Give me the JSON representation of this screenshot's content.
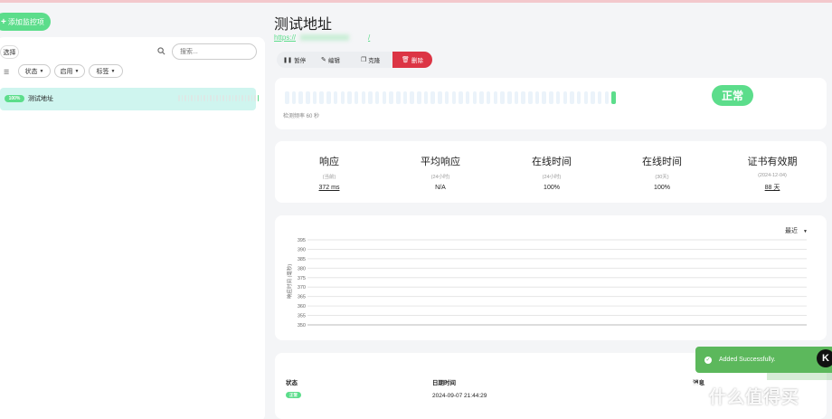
{
  "sidebar": {
    "add_button_label": "添加监控项",
    "select_button_label": "选择",
    "search_placeholder": "搜索...",
    "filters": [
      {
        "label": "状态"
      },
      {
        "label": "启用"
      },
      {
        "label": "标签"
      }
    ],
    "monitors": [
      {
        "uptime_badge": "100%",
        "name": "测试地址",
        "bars_total": 26,
        "bars_up": [
          25
        ]
      }
    ]
  },
  "monitor": {
    "title": "测试地址",
    "url_prefix": "https://",
    "url_suffix": "/",
    "actions": {
      "pause": "暂停",
      "edit": "编辑",
      "clone": "克隆",
      "delete": "删除"
    },
    "heartbeat": {
      "bars_total": 48,
      "up_indices": [
        47
      ],
      "interval_note": "检测频率 60 秒",
      "status_label": "正常"
    },
    "stats": [
      {
        "label": "响应",
        "sub": "(当前)",
        "value": "372 ms",
        "underline": true
      },
      {
        "label": "平均响应",
        "sub": "(24小时)",
        "value": "N/A",
        "underline": false
      },
      {
        "label": "在线时间",
        "sub": "(24小时)",
        "value": "100%",
        "underline": false
      },
      {
        "label": "在线时间",
        "sub": "(30天)",
        "value": "100%",
        "underline": false
      },
      {
        "label": "证书有效期",
        "sub": "(2024-12-04)",
        "value": "88 天",
        "underline": true
      }
    ]
  },
  "chart_data": {
    "type": "line",
    "title": "",
    "xlabel": "",
    "ylabel": "响应时间 (毫秒)",
    "range_selector": "最近",
    "y_ticks": [
      395,
      390,
      385,
      380,
      375,
      370,
      365,
      360,
      355,
      350
    ],
    "ylim": [
      350,
      395
    ],
    "grid": true,
    "series": []
  },
  "events_table": {
    "headers": {
      "status": "状态",
      "datetime": "日期时间",
      "message": "消息"
    },
    "rows": [
      {
        "status": "正常",
        "datetime": "2024-09-07 21:44:29"
      }
    ]
  },
  "toast": {
    "message": "Added Successfully.",
    "icon": "check-icon"
  },
  "watermark": {
    "text": "什么值得买"
  },
  "colors": {
    "accent": "#5cdd8b",
    "danger": "#dc3545",
    "toast": "#5cb85c",
    "selected_row": "#cff5ef"
  }
}
